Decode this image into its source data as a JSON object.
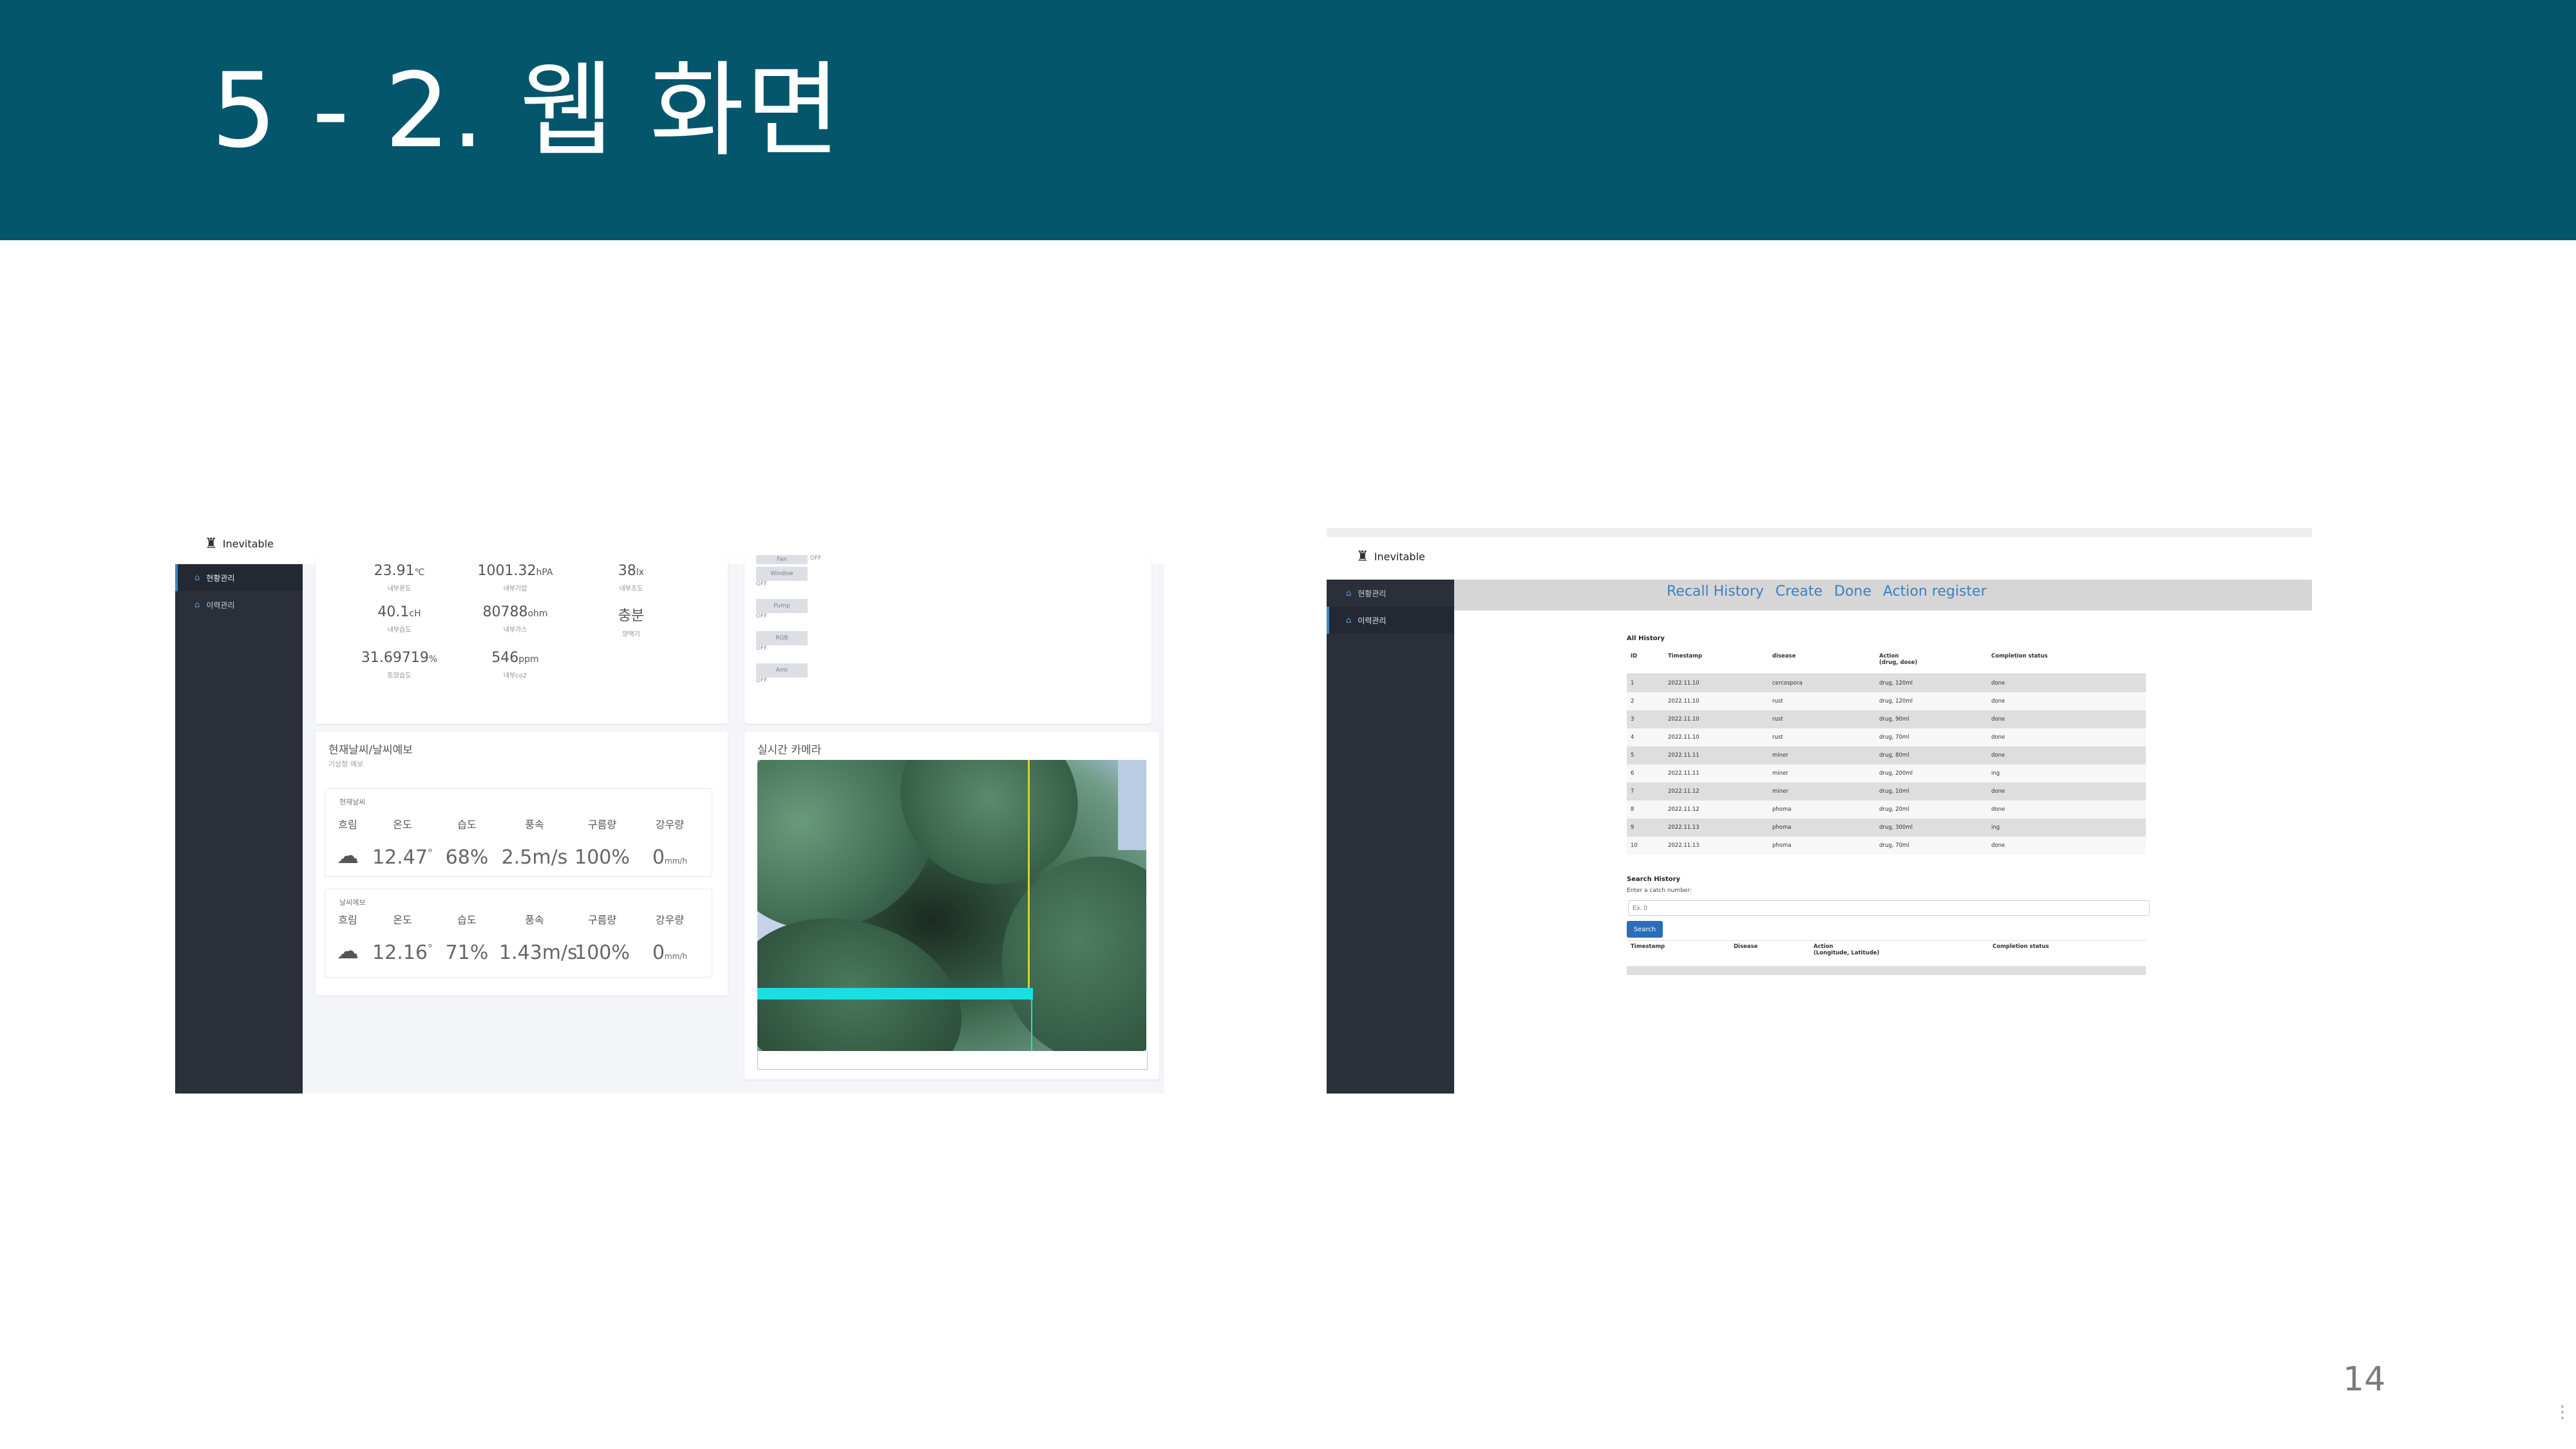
{
  "slide": {
    "title": "5 - 2. 웹 화면",
    "page_number": "14"
  },
  "colors": {
    "header_bg": "#03566b",
    "sidebar_bg": "#2a2f3a",
    "link_blue": "#3f7fbf",
    "detection_box": "#19e0e0",
    "detection_line": "#d8d12a"
  },
  "left_app": {
    "logo_text": "Inevitable",
    "logo_icon": "robot-icon",
    "sidebar": [
      {
        "label": "현황관리",
        "icon": "home-icon"
      },
      {
        "label": "이력관리",
        "icon": "home-icon"
      }
    ],
    "sensors": [
      {
        "value": "23.91",
        "unit": "℃",
        "label": "내부온도"
      },
      {
        "value": "1001.32",
        "unit": "hPA",
        "label": "내부기압"
      },
      {
        "value": "38",
        "unit": "lx",
        "label": "내부조도"
      },
      {
        "value": "40.1",
        "unit": "cH",
        "label": "내부습도"
      },
      {
        "value": "80788",
        "unit": "ohm",
        "label": "내부가스"
      },
      {
        "value": "충분",
        "unit": "",
        "label": "양액기"
      },
      {
        "value": "31.69719",
        "unit": "%",
        "label": "토양습도"
      },
      {
        "value": "546",
        "unit": "ppm",
        "label": "내부co2"
      }
    ],
    "controls": [
      {
        "label": "Fan",
        "state": "OFF"
      },
      {
        "label": "Window",
        "state": "OFF"
      },
      {
        "label": "Pump",
        "state": "OFF"
      },
      {
        "label": "RGB",
        "state": "OFF"
      },
      {
        "label": "Amt",
        "state": "OFF"
      }
    ],
    "weather": {
      "title": "현재날씨/날씨예보",
      "subtitle": "기상청 예보",
      "headers": [
        "흐림",
        "온도",
        "습도",
        "풍속",
        "구름량",
        "강우량"
      ],
      "current": {
        "caption": "현재날씨",
        "icon": "cloud-icon",
        "values": [
          "12.47",
          "68%",
          "2.5m/s",
          "100%",
          "0"
        ],
        "temp_unit": "°",
        "rain_unit": "mm/h"
      },
      "forecast": {
        "caption": "날씨예보",
        "icon": "cloud-icon",
        "values": [
          "12.16",
          "71%",
          "1.43m/s",
          "100%",
          "0"
        ],
        "temp_unit": "°",
        "rain_unit": "mm/h"
      }
    },
    "camera": {
      "title": "실시간 카메라"
    }
  },
  "right_app": {
    "logo_text": "Inevitable",
    "logo_icon": "robot-icon",
    "sidebar": [
      {
        "label": "현황관리",
        "icon": "home-icon"
      },
      {
        "label": "이력관리",
        "icon": "home-icon"
      }
    ],
    "nav": [
      "Recall History",
      "Create",
      "Done",
      "Action register"
    ],
    "all_history": {
      "title": "All History",
      "columns": [
        "ID",
        "Timestamp",
        "disease",
        "Action\n(drug, dose)",
        "Completion status"
      ],
      "rows": [
        [
          "1",
          "2022.11.10",
          "cercospora",
          "drug, 120ml",
          "done"
        ],
        [
          "2",
          "2022.11.10",
          "rust",
          "drug, 120ml",
          "done"
        ],
        [
          "3",
          "2022.11.10",
          "rust",
          "drug, 90ml",
          "done"
        ],
        [
          "4",
          "2022.11.10",
          "rust",
          "drug, 70ml",
          "done"
        ],
        [
          "5",
          "2022.11.11",
          "miner",
          "drug, 80ml",
          "done"
        ],
        [
          "6",
          "2022.11.11",
          "miner",
          "drug, 200ml",
          "ing"
        ],
        [
          "7",
          "2022.11.12",
          "miner",
          "drug, 10ml",
          "done"
        ],
        [
          "8",
          "2022.11.12",
          "phoma",
          "drug, 20ml",
          "done"
        ],
        [
          "9",
          "2022.11.13",
          "phoma",
          "drug, 300ml",
          "ing"
        ],
        [
          "10",
          "2022.11.13",
          "phoma",
          "drug, 70ml",
          "done"
        ]
      ]
    },
    "search": {
      "title": "Search History",
      "label": "Enter a catch number:",
      "placeholder": "Ex. 0",
      "button": "Search",
      "columns": [
        "Timestamp",
        "Disease",
        "Action\n(Longitude, Latitude)",
        "Completion status"
      ]
    }
  }
}
